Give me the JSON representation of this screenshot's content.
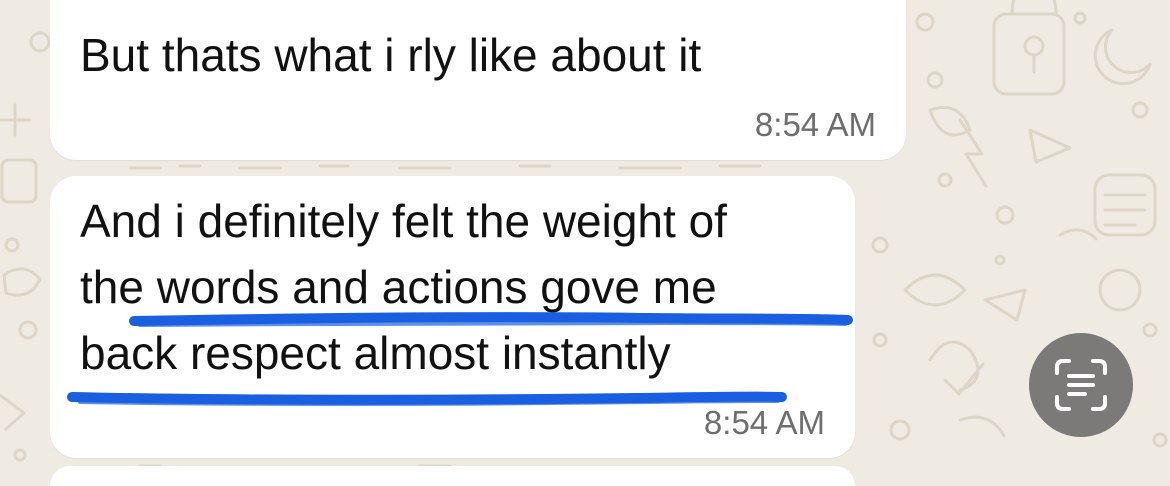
{
  "chat": {
    "messages": [
      {
        "lines": [
          "But thats what i rly like about it"
        ],
        "time": "8:54 AM"
      },
      {
        "lines": [
          "And i definitely felt the weight of",
          "the words and actions gove me",
          "back respect almost instantly"
        ],
        "time": "8:54 AM"
      }
    ]
  },
  "annotation": {
    "color": "#1a5fe0"
  },
  "colors": {
    "background": "#efeae2",
    "bubble": "#ffffff",
    "text": "#111111",
    "timestamp": "#6e6e6e"
  },
  "controls": {
    "live_text_icon": "live-text-scan-icon"
  }
}
